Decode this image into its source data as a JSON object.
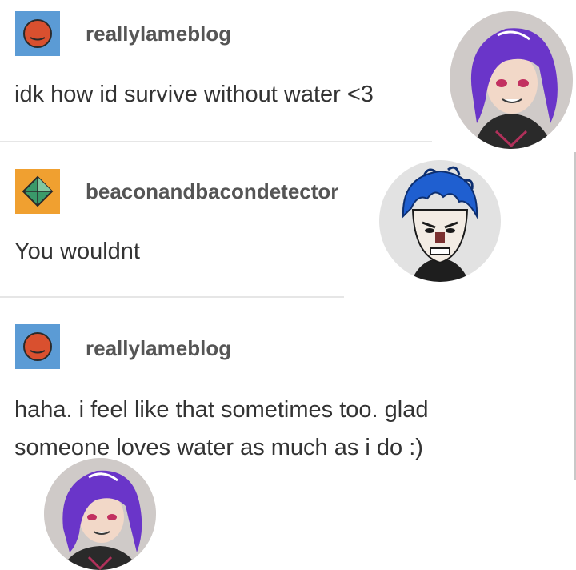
{
  "posts": [
    {
      "blog_name": "reallylameblog",
      "icon": "orange-circle-icon",
      "text": "idk how id survive without water <3"
    },
    {
      "blog_name": "beaconandbacondetector",
      "icon": "green-diamond-icon",
      "text": "You wouldnt"
    },
    {
      "blog_name": "reallylameblog",
      "icon": "orange-circle-icon",
      "text": "haha. i feel like that sometimes too. glad\nsomeone loves water as much as i do :)"
    }
  ],
  "stickers": [
    {
      "name": "purple-hair-avatar-sticker"
    },
    {
      "name": "blue-hair-avatar-sticker"
    },
    {
      "name": "purple-hair-avatar-sticker"
    }
  ],
  "colors": {
    "icon_blue_bg": "#5b9bd5",
    "icon_orange_bg": "#f0a030",
    "orange_circle": "#d9502f",
    "purple_hair": "#6a35c9",
    "blue_hair": "#1f5fd0"
  }
}
